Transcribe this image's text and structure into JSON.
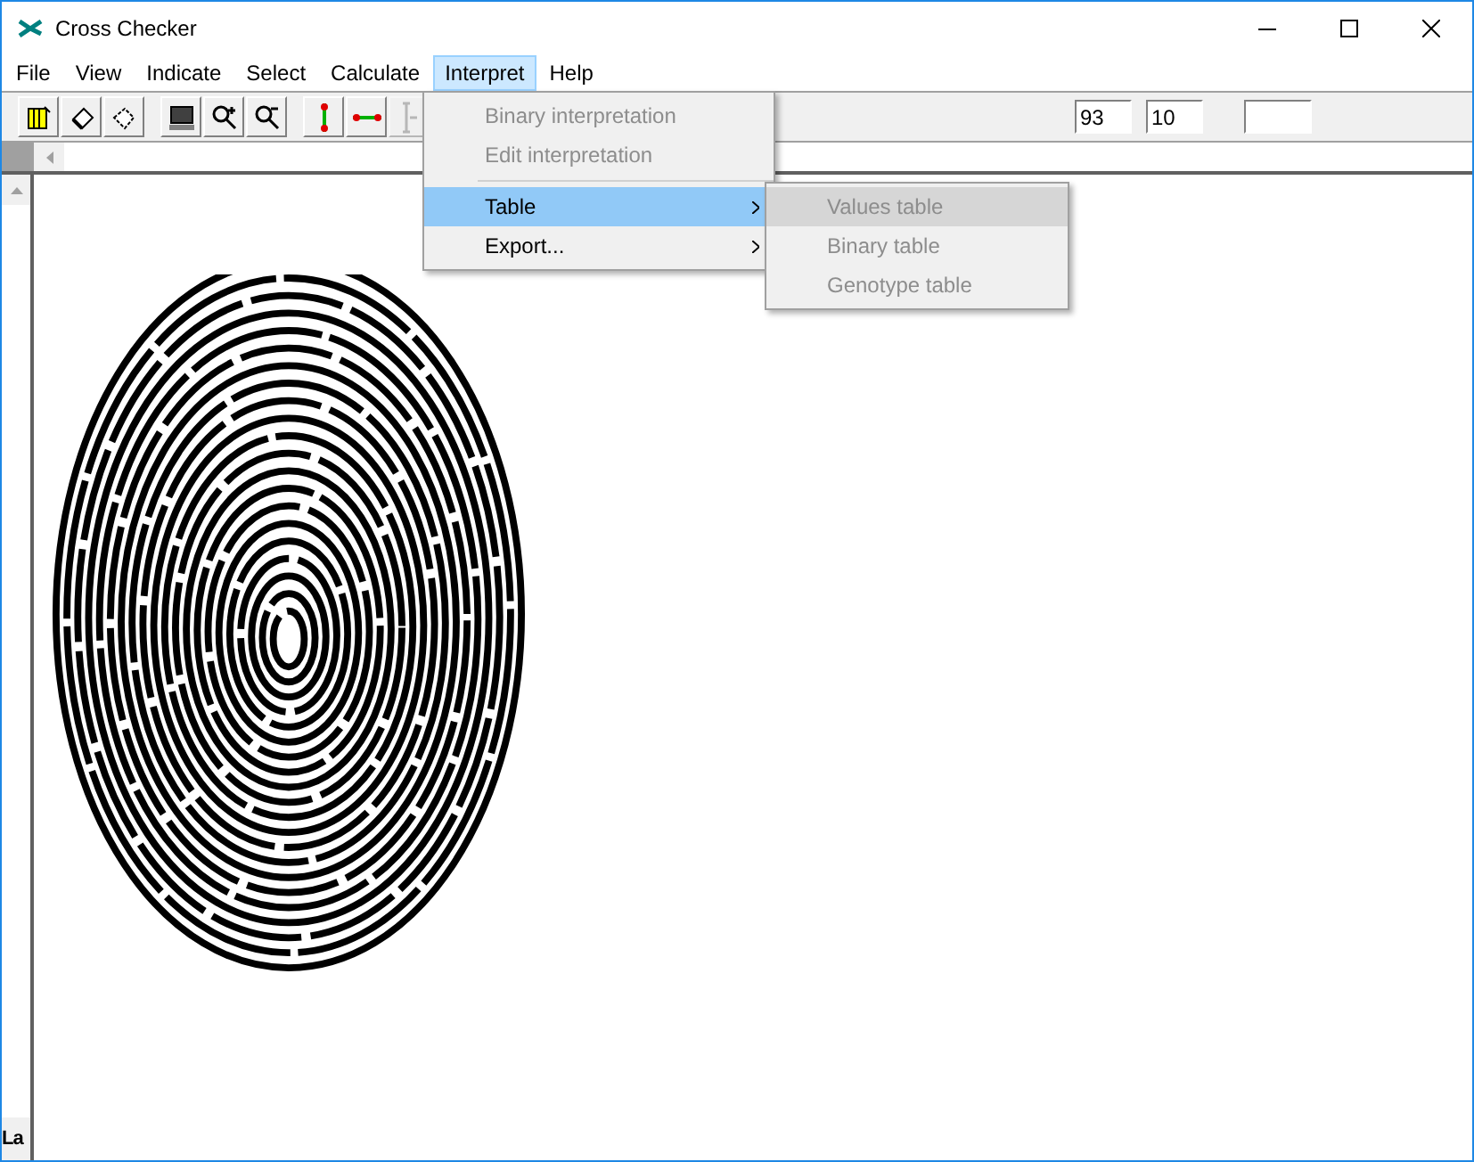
{
  "window": {
    "title": "Cross Checker"
  },
  "menu_bar": [
    {
      "label": "File",
      "selected": false
    },
    {
      "label": "View",
      "selected": false
    },
    {
      "label": "Indicate",
      "selected": false
    },
    {
      "label": "Select",
      "selected": false
    },
    {
      "label": "Calculate",
      "selected": false
    },
    {
      "label": "Interpret",
      "selected": true
    },
    {
      "label": "Help",
      "selected": false
    }
  ],
  "interpret_menu": [
    {
      "kind": "item",
      "label": "Binary interpretation",
      "disabled": true,
      "selected": false,
      "submenu": false
    },
    {
      "kind": "item",
      "label": "Edit interpretation",
      "disabled": true,
      "selected": false,
      "submenu": false
    },
    {
      "kind": "separator"
    },
    {
      "kind": "item",
      "label": "Table",
      "disabled": false,
      "selected": true,
      "submenu": true
    },
    {
      "kind": "item",
      "label": "Export...",
      "disabled": false,
      "selected": false,
      "submenu": true
    }
  ],
  "table_submenu": [
    {
      "label": "Values table",
      "disabled": true,
      "selected": true
    },
    {
      "label": "Binary table",
      "disabled": true,
      "selected": false
    },
    {
      "label": "Genotype table",
      "disabled": true,
      "selected": false
    }
  ],
  "toolbar_fields": [
    {
      "value": "93"
    },
    {
      "value": "10"
    }
  ],
  "side_label": "La"
}
